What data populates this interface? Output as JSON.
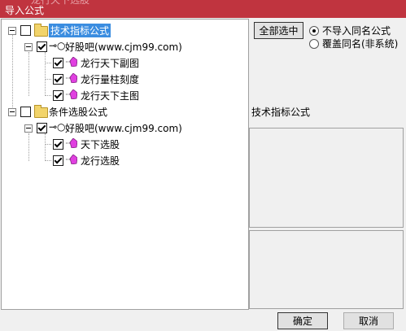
{
  "window": {
    "title": "导入公式",
    "title_behind": "龙行天下选股"
  },
  "tree": {
    "groups": [
      {
        "label": "技术指标公式",
        "checked": false,
        "selected": true,
        "source": {
          "label": "好股吧(www.cjm99.com)",
          "checked": true,
          "items": [
            {
              "label": "龙行天下副图",
              "checked": true
            },
            {
              "label": "龙行量柱刻度",
              "checked": true
            },
            {
              "label": "龙行天下主图",
              "checked": true
            }
          ]
        }
      },
      {
        "label": "条件选股公式",
        "checked": false,
        "selected": false,
        "source": {
          "label": "好股吧(www.cjm99.com)",
          "checked": true,
          "items": [
            {
              "label": "天下选股",
              "checked": true
            },
            {
              "label": "龙行选股",
              "checked": true
            }
          ]
        }
      }
    ]
  },
  "options": {
    "select_all_label": "全部选中",
    "radio_skip_label": "不导入同名公式",
    "radio_overwrite_label": "覆盖同名(非系统)",
    "selected_option": "不导入同名公式"
  },
  "info": {
    "category_label": "技术指标公式"
  },
  "footer": {
    "ok_label": "确定",
    "cancel_label": "取消"
  },
  "colors": {
    "titlebar": "#c0343f",
    "selection": "#3b8de0",
    "folder": "#f2d46b",
    "leaf_icon": "#e040e0"
  }
}
